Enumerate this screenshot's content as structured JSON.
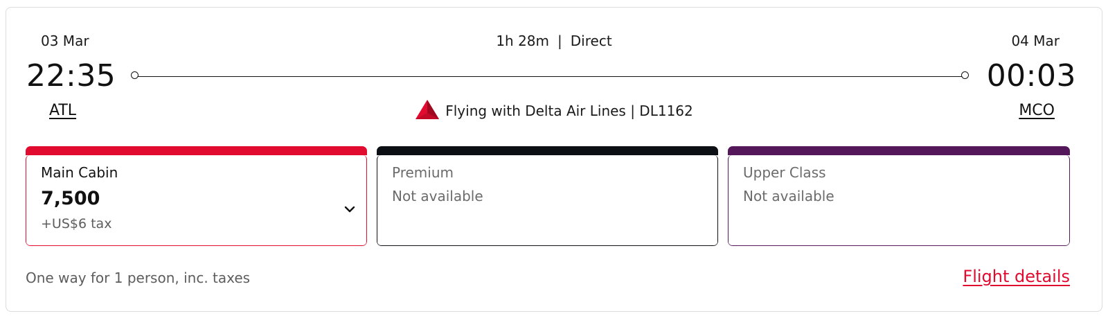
{
  "flight": {
    "departure": {
      "date": "03 Mar",
      "time": "22:35",
      "airport": "ATL"
    },
    "arrival": {
      "date": "04 Mar",
      "time": "00:03",
      "airport": "MCO"
    },
    "duration": "1h 28m",
    "separator": "|",
    "stops": "Direct",
    "carrier_text": "Flying with Delta Air Lines | DL1162",
    "carrier_logo_icon": "delta-widget-icon"
  },
  "fares": [
    {
      "name": "Main Cabin",
      "price": "7,500",
      "tax": "+US$6 tax",
      "accent": "#e10a2f"
    },
    {
      "name": "Premium",
      "status": "Not available",
      "accent": "#0c0f14"
    },
    {
      "name": "Upper Class",
      "status": "Not available",
      "accent": "#54185a"
    }
  ],
  "footer": {
    "note": "One way for 1 person, inc. taxes",
    "details_link": "Flight details"
  },
  "colors": {
    "brand_red": "#e10a2f",
    "premium": "#0c0f14",
    "upper": "#54185a"
  }
}
